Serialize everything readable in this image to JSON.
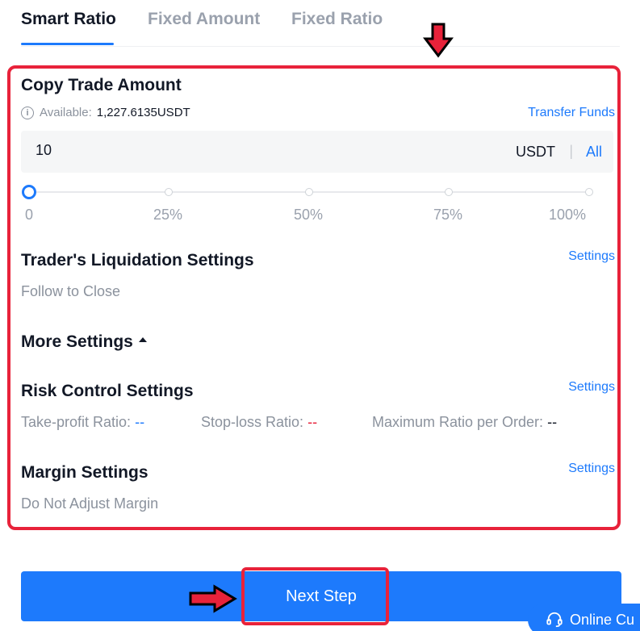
{
  "tabs": [
    {
      "label": "Smart Ratio",
      "active": true
    },
    {
      "label": "Fixed Amount",
      "active": false
    },
    {
      "label": "Fixed Ratio",
      "active": false
    }
  ],
  "copy_trade": {
    "title": "Copy Trade Amount",
    "available_label": "Available:",
    "available_value": "1,227.6135USDT",
    "transfer_link": "Transfer Funds",
    "amount_value": "10",
    "amount_unit": "USDT",
    "separator": "|",
    "all_label": "All",
    "slider_value_percent": 0,
    "slider_labels": [
      "0",
      "25%",
      "50%",
      "75%",
      "100%"
    ]
  },
  "liquidation": {
    "title": "Trader's Liquidation Settings",
    "settings_link": "Settings",
    "value": "Follow to Close"
  },
  "more_settings": {
    "label": "More Settings"
  },
  "risk_control": {
    "title": "Risk Control Settings",
    "settings_link": "Settings",
    "take_profit_label": "Take-profit Ratio:",
    "take_profit_value": "--",
    "stop_loss_label": "Stop-loss Ratio:",
    "stop_loss_value": "--",
    "max_ratio_label": "Maximum Ratio per Order:",
    "max_ratio_value": "--"
  },
  "margin": {
    "title": "Margin Settings",
    "settings_link": "Settings",
    "value": "Do Not Adjust Margin"
  },
  "next_button": {
    "label": "Next Step"
  },
  "online_support": {
    "label": "Online Cu"
  },
  "colors": {
    "accent": "#1d7afc",
    "highlight": "#e8223a",
    "arrow": "#e8223a"
  },
  "icons": {
    "info": "info-icon",
    "caret": "caret-up-icon",
    "headset": "headset-icon",
    "arrow_down": "arrow-down-icon",
    "arrow_right": "arrow-right-icon"
  }
}
